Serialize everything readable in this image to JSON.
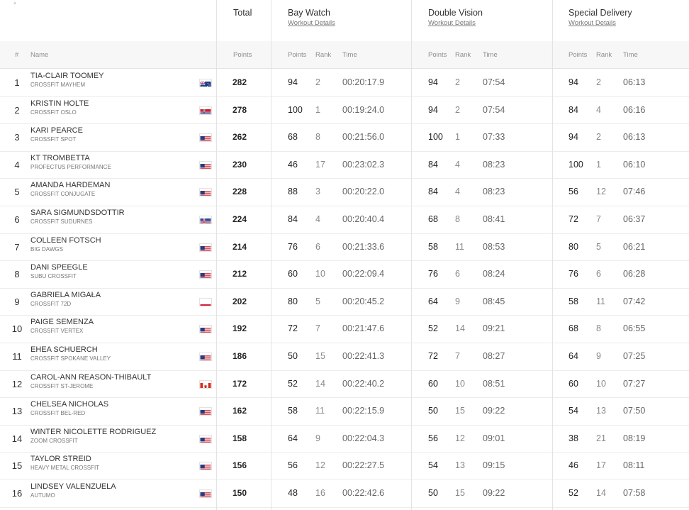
{
  "header": {
    "total": "Total",
    "workouts": [
      {
        "name": "Bay Watch",
        "link": "Workout Details"
      },
      {
        "name": "Double Vision",
        "link": "Workout Details"
      },
      {
        "name": "Special Delivery",
        "link": "Workout Details"
      }
    ]
  },
  "subheader": {
    "hash": "#",
    "name": "Name",
    "points": "Points",
    "rank": "Rank",
    "time": "Time"
  },
  "rows": [
    {
      "rank": "1",
      "name": "TIA-CLAIR TOOMEY",
      "affiliate": "CROSSFIT MAYHEM",
      "flag": "AU",
      "total": "282",
      "workouts": [
        {
          "points": "94",
          "rank": "2",
          "time": "00:20:17.9"
        },
        {
          "points": "94",
          "rank": "2",
          "time": "07:54"
        },
        {
          "points": "94",
          "rank": "2",
          "time": "06:13"
        }
      ]
    },
    {
      "rank": "2",
      "name": "KRISTIN HOLTE",
      "affiliate": "CROSSFIT OSLO",
      "flag": "NO",
      "total": "278",
      "workouts": [
        {
          "points": "100",
          "rank": "1",
          "time": "00:19:24.0"
        },
        {
          "points": "94",
          "rank": "2",
          "time": "07:54"
        },
        {
          "points": "84",
          "rank": "4",
          "time": "06:16"
        }
      ]
    },
    {
      "rank": "3",
      "name": "KARI PEARCE",
      "affiliate": "CROSSFIT SPOT",
      "flag": "US",
      "total": "262",
      "workouts": [
        {
          "points": "68",
          "rank": "8",
          "time": "00:21:56.0"
        },
        {
          "points": "100",
          "rank": "1",
          "time": "07:33"
        },
        {
          "points": "94",
          "rank": "2",
          "time": "06:13"
        }
      ]
    },
    {
      "rank": "4",
      "name": "KT TROMBETTA",
      "affiliate": "PROFECTUS PERFORMANCE",
      "flag": "US",
      "total": "230",
      "workouts": [
        {
          "points": "46",
          "rank": "17",
          "time": "00:23:02.3"
        },
        {
          "points": "84",
          "rank": "4",
          "time": "08:23"
        },
        {
          "points": "100",
          "rank": "1",
          "time": "06:10"
        }
      ]
    },
    {
      "rank": "5",
      "name": "AMANDA HARDEMAN",
      "affiliate": "CROSSFIT CONJUGATE",
      "flag": "US",
      "total": "228",
      "workouts": [
        {
          "points": "88",
          "rank": "3",
          "time": "00:20:22.0"
        },
        {
          "points": "84",
          "rank": "4",
          "time": "08:23"
        },
        {
          "points": "56",
          "rank": "12",
          "time": "07:46"
        }
      ]
    },
    {
      "rank": "6",
      "name": "SARA SIGMUNDSDOTTIR",
      "affiliate": "CROSSFIT SUDURNES",
      "flag": "IS",
      "total": "224",
      "workouts": [
        {
          "points": "84",
          "rank": "4",
          "time": "00:20:40.4"
        },
        {
          "points": "68",
          "rank": "8",
          "time": "08:41"
        },
        {
          "points": "72",
          "rank": "7",
          "time": "06:37"
        }
      ]
    },
    {
      "rank": "7",
      "name": "COLLEEN FOTSCH",
      "affiliate": "BIG DAWGS",
      "flag": "US",
      "total": "214",
      "workouts": [
        {
          "points": "76",
          "rank": "6",
          "time": "00:21:33.6"
        },
        {
          "points": "58",
          "rank": "11",
          "time": "08:53"
        },
        {
          "points": "80",
          "rank": "5",
          "time": "06:21"
        }
      ]
    },
    {
      "rank": "8",
      "name": "DANI SPEEGLE",
      "affiliate": "SUBU CROSSFIT",
      "flag": "US",
      "total": "212",
      "workouts": [
        {
          "points": "60",
          "rank": "10",
          "time": "00:22:09.4"
        },
        {
          "points": "76",
          "rank": "6",
          "time": "08:24"
        },
        {
          "points": "76",
          "rank": "6",
          "time": "06:28"
        }
      ]
    },
    {
      "rank": "9",
      "name": "GABRIELA MIGAŁA",
      "affiliate": "CROSSFIT 72D",
      "flag": "PL",
      "total": "202",
      "workouts": [
        {
          "points": "80",
          "rank": "5",
          "time": "00:20:45.2"
        },
        {
          "points": "64",
          "rank": "9",
          "time": "08:45"
        },
        {
          "points": "58",
          "rank": "11",
          "time": "07:42"
        }
      ]
    },
    {
      "rank": "10",
      "name": "PAIGE SEMENZA",
      "affiliate": "CROSSFIT VERTEX",
      "flag": "US",
      "total": "192",
      "workouts": [
        {
          "points": "72",
          "rank": "7",
          "time": "00:21:47.6"
        },
        {
          "points": "52",
          "rank": "14",
          "time": "09:21"
        },
        {
          "points": "68",
          "rank": "8",
          "time": "06:55"
        }
      ]
    },
    {
      "rank": "11",
      "name": "EHEA SCHUERCH",
      "affiliate": "CROSSFIT SPOKANE VALLEY",
      "flag": "US",
      "total": "186",
      "workouts": [
        {
          "points": "50",
          "rank": "15",
          "time": "00:22:41.3"
        },
        {
          "points": "72",
          "rank": "7",
          "time": "08:27"
        },
        {
          "points": "64",
          "rank": "9",
          "time": "07:25"
        }
      ]
    },
    {
      "rank": "12",
      "name": "CAROL-ANN REASON-THIBAULT",
      "affiliate": "CROSSFIT ST-JEROME",
      "flag": "CA",
      "total": "172",
      "workouts": [
        {
          "points": "52",
          "rank": "14",
          "time": "00:22:40.2"
        },
        {
          "points": "60",
          "rank": "10",
          "time": "08:51"
        },
        {
          "points": "60",
          "rank": "10",
          "time": "07:27"
        }
      ]
    },
    {
      "rank": "13",
      "name": "CHELSEA NICHOLAS",
      "affiliate": "CROSSFIT BEL-RED",
      "flag": "US",
      "total": "162",
      "workouts": [
        {
          "points": "58",
          "rank": "11",
          "time": "00:22:15.9"
        },
        {
          "points": "50",
          "rank": "15",
          "time": "09:22"
        },
        {
          "points": "54",
          "rank": "13",
          "time": "07:50"
        }
      ]
    },
    {
      "rank": "14",
      "name": "WINTER NICOLETTE RODRIGUEZ",
      "affiliate": "ZOOM CROSSFIT",
      "flag": "US",
      "total": "158",
      "workouts": [
        {
          "points": "64",
          "rank": "9",
          "time": "00:22:04.3"
        },
        {
          "points": "56",
          "rank": "12",
          "time": "09:01"
        },
        {
          "points": "38",
          "rank": "21",
          "time": "08:19"
        }
      ]
    },
    {
      "rank": "15",
      "name": "TAYLOR STREID",
      "affiliate": "HEAVY METAL CROSSFIT",
      "flag": "US",
      "total": "156",
      "workouts": [
        {
          "points": "56",
          "rank": "12",
          "time": "00:22:27.5"
        },
        {
          "points": "54",
          "rank": "13",
          "time": "09:15"
        },
        {
          "points": "46",
          "rank": "17",
          "time": "08:11"
        }
      ]
    },
    {
      "rank": "16",
      "name": "LINDSEY VALENZUELA",
      "affiliate": "AUTUMO",
      "flag": "US",
      "total": "150",
      "workouts": [
        {
          "points": "48",
          "rank": "16",
          "time": "00:22:42.6"
        },
        {
          "points": "50",
          "rank": "15",
          "time": "09:22"
        },
        {
          "points": "52",
          "rank": "14",
          "time": "07:58"
        }
      ]
    }
  ]
}
